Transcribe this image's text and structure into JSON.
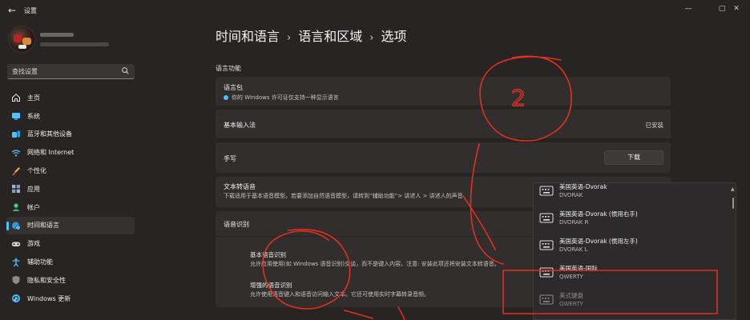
{
  "window": {
    "title": "设置",
    "back_glyph": "←",
    "minimize_glyph": "—",
    "maximize_glyph": "▢",
    "close_glyph": "✕"
  },
  "search": {
    "placeholder": "查找设置"
  },
  "sidebar": {
    "items": [
      {
        "label": "主页",
        "icon": "home-icon",
        "color": "#e9e9e9"
      },
      {
        "label": "系统",
        "icon": "system-icon",
        "color": "#4cc2ff"
      },
      {
        "label": "蓝牙和其他设备",
        "icon": "bluetooth-devices-icon",
        "color": "#4cc2ff"
      },
      {
        "label": "网络和 Internet",
        "icon": "wifi-icon",
        "color": "#4cc2ff"
      },
      {
        "label": "个性化",
        "icon": "brush-icon",
        "color": "#f7a95c"
      },
      {
        "label": "应用",
        "icon": "apps-icon",
        "color": "#9fb6d6"
      },
      {
        "label": "帐户",
        "icon": "account-icon",
        "color": "#3ad18a"
      },
      {
        "label": "时间和语言",
        "icon": "globe-clock-icon",
        "color": "#4cc2ff",
        "active": true
      },
      {
        "label": "游戏",
        "icon": "gamepad-icon",
        "color": "#d0d0d0"
      },
      {
        "label": "辅助功能",
        "icon": "accessibility-icon",
        "color": "#4cc2ff"
      },
      {
        "label": "隐私和安全性",
        "icon": "shield-icon",
        "color": "#8a8a8a"
      },
      {
        "label": "Windows 更新",
        "icon": "update-icon",
        "color": "#4cc2ff"
      }
    ]
  },
  "breadcrumb": {
    "level1": "时间和语言",
    "level2": "语言和区域",
    "current": "选项",
    "separator": "›"
  },
  "main": {
    "section_label": "语言功能",
    "language_pack": {
      "title": "语言包",
      "status": "你的 Windows 许可证仅支持一种显示语言"
    },
    "basic_input": {
      "title": "基本输入法",
      "value": "已安装"
    },
    "handwriting": {
      "title": "手写",
      "button": "下载"
    },
    "tts": {
      "title": "文本转语音",
      "desc": "下载适用于基本语音模型。若要添加自然语音模型，请转到“辅助功能”> 讲述人 > 讲述人的声音"
    },
    "speech": {
      "title": "语音识别",
      "basic_title": "基本语音识别",
      "basic_desc": "允许应用使用(如 Windows 语音识别)交谈，而不是键入内容。注意: 安装此项还将安装文本转语音。",
      "enhanced_title": "增强的语音识别",
      "enhanced_desc": "允许使用语音键入和语音访问输入文本。它还可使用实时字幕转录音频。"
    }
  },
  "keyboard_dropdown": {
    "scroll_up_glyph": "▲",
    "items": [
      {
        "name": "美国英语-Dvorak",
        "code": "DVORAK"
      },
      {
        "name": "美国英语-Dvorak (惯用右手)",
        "code": "DVORAK R"
      },
      {
        "name": "美国英语-Dvorak (惯用左手)",
        "code": "DVORAK L"
      },
      {
        "name": "美国英语-国际",
        "code": "QWERTY"
      },
      {
        "name": "美式键盘",
        "code": "QWERTY",
        "disabled": true
      }
    ]
  },
  "annotations": {
    "circle_1_digit": "2",
    "color": "#e0301e"
  }
}
